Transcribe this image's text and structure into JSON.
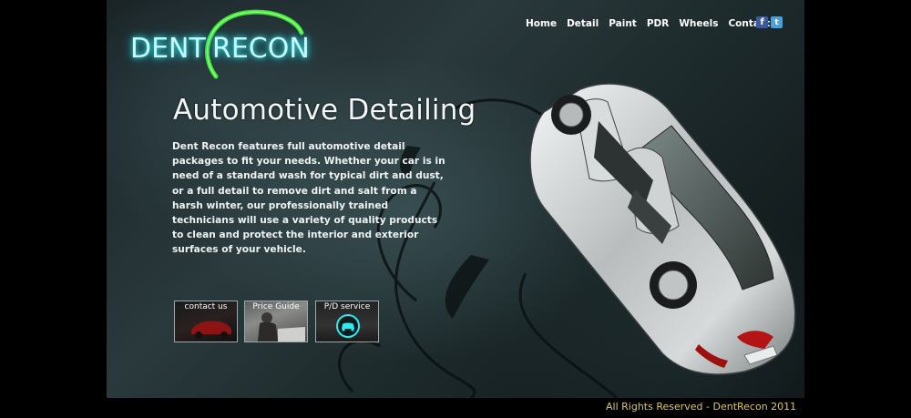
{
  "logo": {
    "word_left": "DENT",
    "word_right": "RECON"
  },
  "nav": {
    "items": [
      {
        "label": "Home"
      },
      {
        "label": "Detail"
      },
      {
        "label": "Paint"
      },
      {
        "label": "PDR"
      },
      {
        "label": "Wheels"
      },
      {
        "label": "Contact"
      }
    ]
  },
  "social": {
    "facebook_glyph": "f",
    "twitter_glyph": "t",
    "facebook_icon": "facebook-icon",
    "twitter_icon": "twitter-icon"
  },
  "main": {
    "heading": "Automotive Detailing",
    "body": "Dent Recon features full automotive detail packages to fit your needs. Whether your car is in need of a standard wash for typical dirt and dust, or a full detail to remove dirt and salt from a harsh winter, our professionally trained technicians will use a variety of quality products to clean and protect the interior and exterior surfaces of your vehicle."
  },
  "buttons": {
    "contact": "contact us",
    "price": "Price Guide",
    "pd": "P/D service"
  },
  "footer": {
    "copyright": "All Rights Reserved - DentRecon 2011"
  },
  "colors": {
    "accent_glow": "#2ee9f0",
    "logo_arc": "#3cf03c",
    "footer_text": "#d8c56c"
  }
}
